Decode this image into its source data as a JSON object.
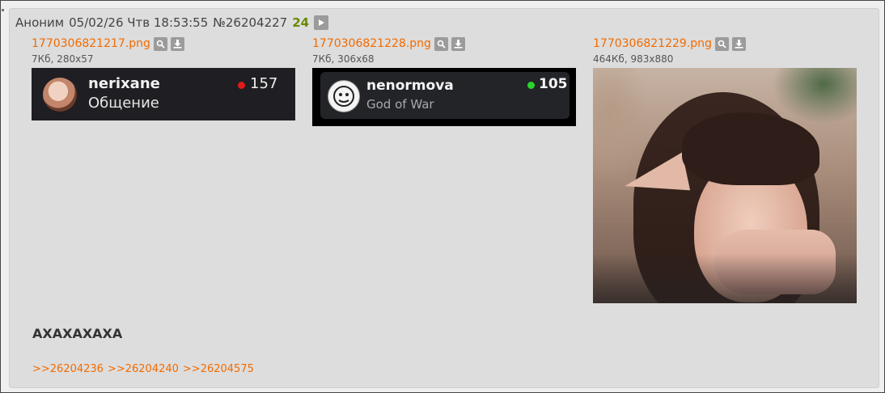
{
  "post": {
    "author": "Аноним",
    "date": "05/02/26 Чтв 18:53:55",
    "number": "№26204227",
    "reply_count": "24"
  },
  "files": [
    {
      "name": "1770306821217.png",
      "meta": "7Кб, 280x57",
      "preview": {
        "username": "nerixane",
        "subtitle": "Общение",
        "count": "157",
        "status_color": "#e01b1b"
      }
    },
    {
      "name": "1770306821228.png",
      "meta": "7Кб, 306x68",
      "preview": {
        "username": "nenormova",
        "subtitle": "God of War",
        "count": "105",
        "status_color": "#2ad52a"
      }
    },
    {
      "name": "1770306821229.png",
      "meta": "464Кб, 983x880"
    }
  ],
  "comment": "АХАХАХАХА",
  "reply_links": [
    ">>26204236",
    ">>26204240",
    ">>26204575"
  ],
  "icons": {
    "play": "play-icon",
    "search": "magnifier-icon",
    "download": "download-icon"
  },
  "colors": {
    "accent_link": "#f26b00",
    "reply_count": "#6a8a00",
    "post_background": "#dddddd"
  }
}
